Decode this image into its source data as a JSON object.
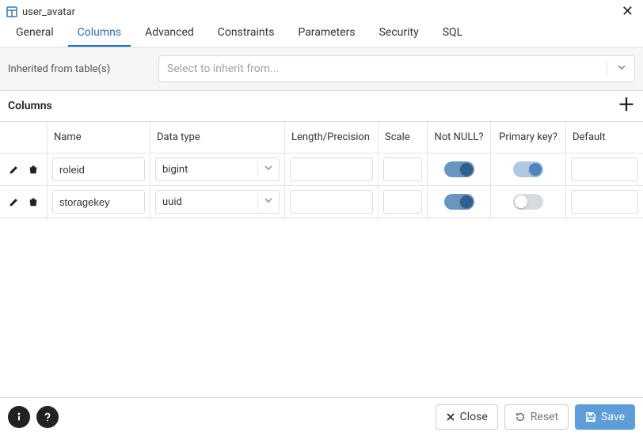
{
  "title": "user_avatar",
  "tabs": [
    "General",
    "Columns",
    "Advanced",
    "Constraints",
    "Parameters",
    "Security",
    "SQL"
  ],
  "active_tab": "Columns",
  "inherit": {
    "label": "Inherited from table(s)",
    "placeholder": "Select to inherit from..."
  },
  "columns_section": {
    "title": "Columns",
    "headers": {
      "name": "Name",
      "data_type": "Data type",
      "length": "Length/Precision",
      "scale": "Scale",
      "not_null": "Not NULL?",
      "primary_key": "Primary key?",
      "default": "Default"
    },
    "rows": [
      {
        "name": "roleid",
        "data_type": "bigint",
        "length": "",
        "scale": "",
        "not_null": true,
        "primary_key": true,
        "default": ""
      },
      {
        "name": "storagekey",
        "data_type": "uuid",
        "length": "",
        "scale": "",
        "not_null": true,
        "primary_key": false,
        "default": ""
      }
    ]
  },
  "footer": {
    "close": "Close",
    "reset": "Reset",
    "save": "Save"
  }
}
